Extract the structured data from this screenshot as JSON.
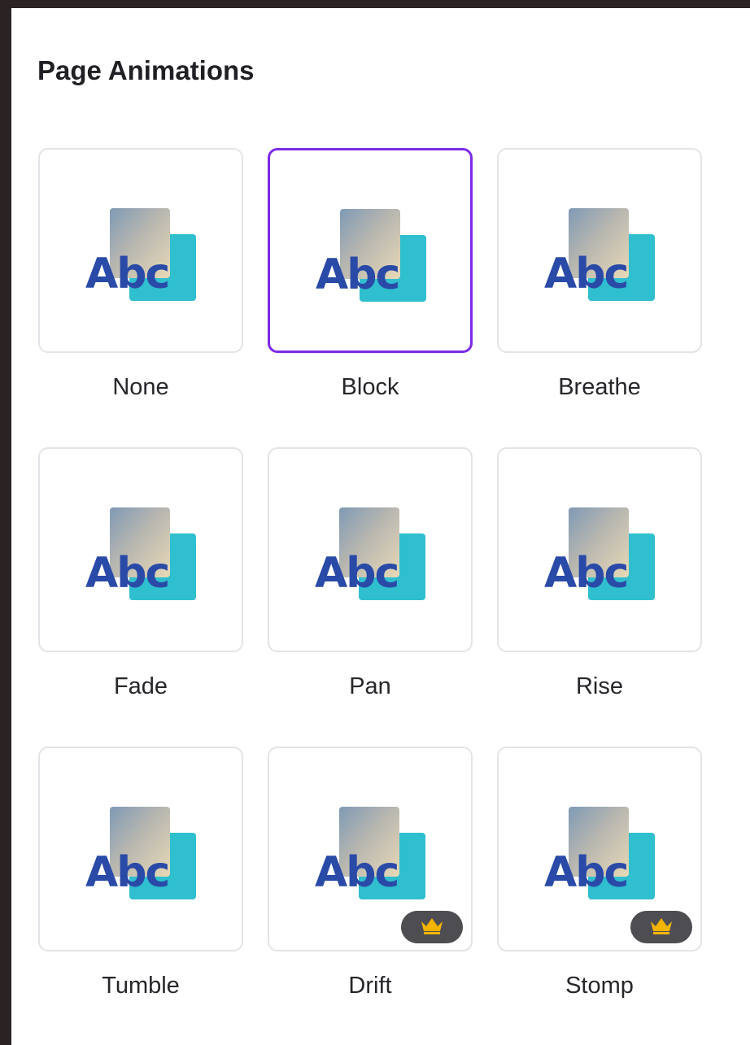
{
  "panel": {
    "title": "Page Animations"
  },
  "animations": [
    {
      "label": "None",
      "selected": false,
      "premium": false
    },
    {
      "label": "Block",
      "selected": true,
      "premium": false
    },
    {
      "label": "Breathe",
      "selected": false,
      "premium": false
    },
    {
      "label": "Fade",
      "selected": false,
      "premium": false
    },
    {
      "label": "Pan",
      "selected": false,
      "premium": false
    },
    {
      "label": "Rise",
      "selected": false,
      "premium": false
    },
    {
      "label": "Tumble",
      "selected": false,
      "premium": false
    },
    {
      "label": "Drift",
      "selected": false,
      "premium": true
    },
    {
      "label": "Stomp",
      "selected": false,
      "premium": true
    }
  ],
  "thumbnail": {
    "text": "Abc",
    "text_color": "#2a4aa8",
    "block_color": "#2fbfcf"
  },
  "colors": {
    "selection_border": "#7d2ae8",
    "crown_badge": "#4e4e52",
    "crown": "#f4b400"
  },
  "icons": {
    "premium": "crown-icon"
  }
}
